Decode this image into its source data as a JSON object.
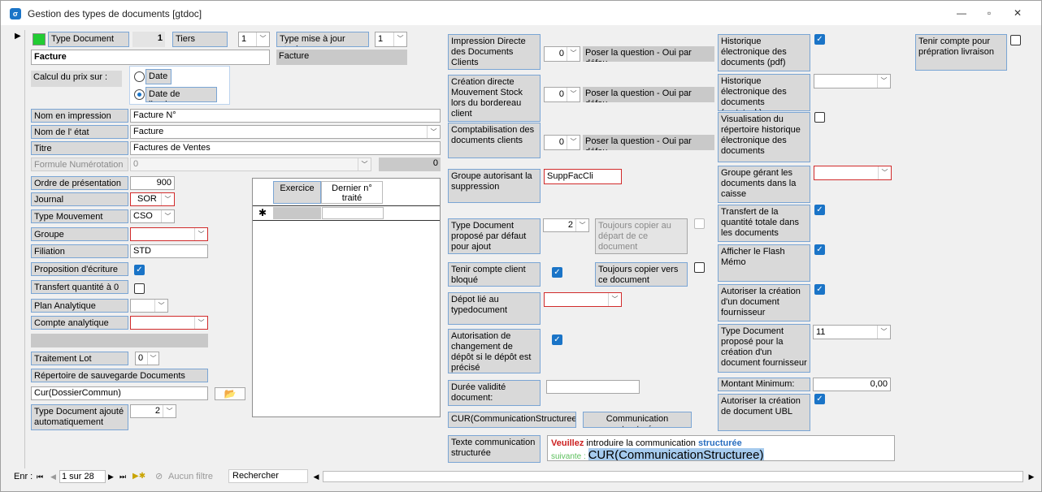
{
  "window": {
    "title": "Gestion des types de documents [gtdoc]",
    "icon": "app-icon",
    "minimize": "minimize-icon",
    "restore": "restore-icon",
    "close": "close-icon"
  },
  "colors": {
    "accent": "#1a74c7",
    "error_border": "#d12b2b",
    "green_swatch": "#22cc33"
  },
  "left": {
    "type_document_label": "Type Document",
    "type_document_value": "1",
    "tiers_label": "Tiers",
    "tiers_value": "1",
    "type_mise_stock_label": "Type mise à jour stock",
    "type_mise_stock_value": "1",
    "name_value": "Facture",
    "stock_name_value": "Facture",
    "calcul_prix_label": "Calcul du prix sur :",
    "radio_date": "Date",
    "radio_livraison": "Date de livraison",
    "nom_impression_label": "Nom en impression",
    "nom_impression_value": "Facture N°",
    "nom_etat_label": "Nom de l' état",
    "nom_etat_value": "Facture",
    "titre_label": "Titre",
    "titre_value": "Factures de Ventes",
    "formule_label": "Formule Numérotation",
    "formule_value": "0",
    "formule_count": "0",
    "ordre_label": "Ordre de présentation",
    "ordre_value": "900",
    "journal_label": "Journal",
    "journal_value": "SOR",
    "type_mouvement_label": "Type Mouvement",
    "type_mouvement_value": "CSO",
    "groupe_label": "Groupe",
    "groupe_value": "",
    "filiation_label": "Filiation",
    "filiation_value": "STD",
    "proposition_label": "Proposition d'écriture",
    "transfert_label": "Transfert quantité à 0",
    "plan_analytique_label": "Plan Analytique",
    "compte_analytique_label": "Compte analytique",
    "traitement_lot_label": "Traitement Lot Garantie",
    "traitement_lot_value": "0",
    "repertoire_label": "Répertoire de sauvegarde Documents Word",
    "repertoire_value": "Cur(DossierCommun)",
    "type_doc_ajoute_label": "Type Document ajouté automatiquement",
    "type_doc_ajoute_value": "2"
  },
  "subform": {
    "col_exercice": "Exercice",
    "col_dernier": "Dernier n° traité",
    "new_row_marker": "✱"
  },
  "middle": {
    "impression_label": "Impression Directe des Documents Clients",
    "impression_value": "0",
    "poser1": "Poser la question - Oui par défau",
    "creation_label": "Création directe Mouvement Stock lors du bordereau client",
    "creation_value": "0",
    "poser2": "Poser la question - Oui par défau",
    "compta_label": "Comptabilisation des documents clients",
    "compta_value": "0",
    "poser3": "Poser la question - Oui par défau",
    "groupe_supp_label": "Groupe autorisant la suppression",
    "groupe_supp_value": "SuppFacCli",
    "type_propose_label": "Type Document proposé par défaut pour ajout",
    "type_propose_value": "2",
    "toujours_copier_depart": "Toujours copier au départ de ce document",
    "tenir_bloque_label": "Tenir compte client bloqué",
    "toujours_copier_vers": "Toujours copier vers ce document",
    "depot_label": "Dépot lié au typedocument",
    "autorisation_depot_label": "Autorisation de changement de dépôt si le dépôt est précisé",
    "duree_label": "Durée validité document:",
    "duree_value": "",
    "cur_btn": "CUR(CommunicationStructuree)",
    "comm_btn": "Communication structurée",
    "texte_comm_label": "Texte communication structurée",
    "note_red": "Veuillez",
    "note_mid": " introduire la communication ",
    "note_blue": "structurée",
    "note_line2_green": "suivante : ",
    "note_line2_big": "CUR(CommunicationStructuree)"
  },
  "right": {
    "hist_pdf_label": "Historique électronique des documents (pdf)",
    "hist_mvt_label": "Historique électronique des documents (mvtstock)",
    "visu_label": "Visualisation du répertoire historique électronique des documents",
    "groupe_caisse_label": "Groupe gérant les documents dans la caisse",
    "transfert_total_label": "Transfert de la quantité totale dans les documents",
    "flash_label": "Afficher le Flash Mémo",
    "autoriser_fourn_label": "Autoriser la création d'un document fournisseur",
    "type_fourn_label": "Type Document proposé pour la création d'un document fournisseur",
    "type_fourn_value": "11",
    "montant_label": "Montant Minimum:",
    "montant_value": "0,00",
    "ubl_label": "Autoriser la création de document UBL",
    "tenir_livraison_label": "Tenir compte pour prépration livraison"
  },
  "status": {
    "enr_label": "Enr :",
    "record": "1 sur 28",
    "filter": "Aucun filtre",
    "search": "Rechercher"
  }
}
